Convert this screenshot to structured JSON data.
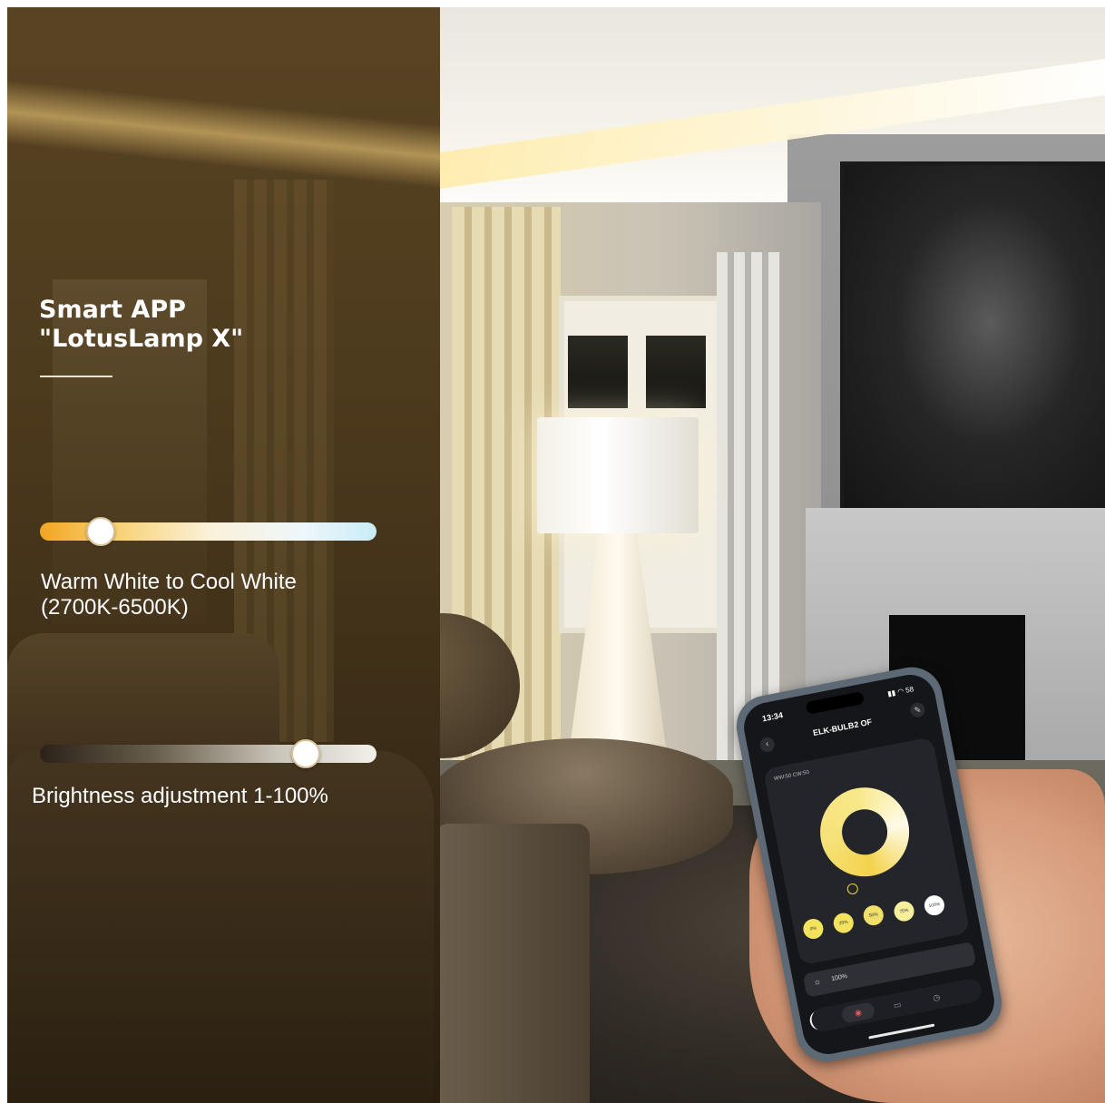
{
  "panel": {
    "title_line1": "Smart APP",
    "title_line2": "\"LotusLamp X\"",
    "color_temp": {
      "caption_line1": "Warm White to Cool White",
      "caption_line2": "(2700K-6500K)",
      "level": 0.18,
      "gradient_colors": [
        "#f2a522",
        "#fbf1d8",
        "#c9ecf7"
      ]
    },
    "brightness": {
      "caption": "Brightness adjustment 1-100%",
      "level": 0.79
    }
  },
  "phone": {
    "time": "13:34",
    "status_icons": "▮▮ ◠ 58",
    "device_name": "ELK-BULB2 OF",
    "card_label": "WW:50 CW:50",
    "presets": [
      {
        "label": "0%",
        "color": "#f3e25b"
      },
      {
        "label": "25%",
        "color": "#f3e25b"
      },
      {
        "label": "50%",
        "color": "#f0df6a"
      },
      {
        "label": "75%",
        "color": "#f7ef9a"
      },
      {
        "label": "100%",
        "color": "#ffffff"
      }
    ],
    "brightness_value": "100%",
    "icons": {
      "back": "chevron-left-icon",
      "edit": "pencil-icon",
      "sun": "sun-icon",
      "power": "power-icon"
    }
  }
}
